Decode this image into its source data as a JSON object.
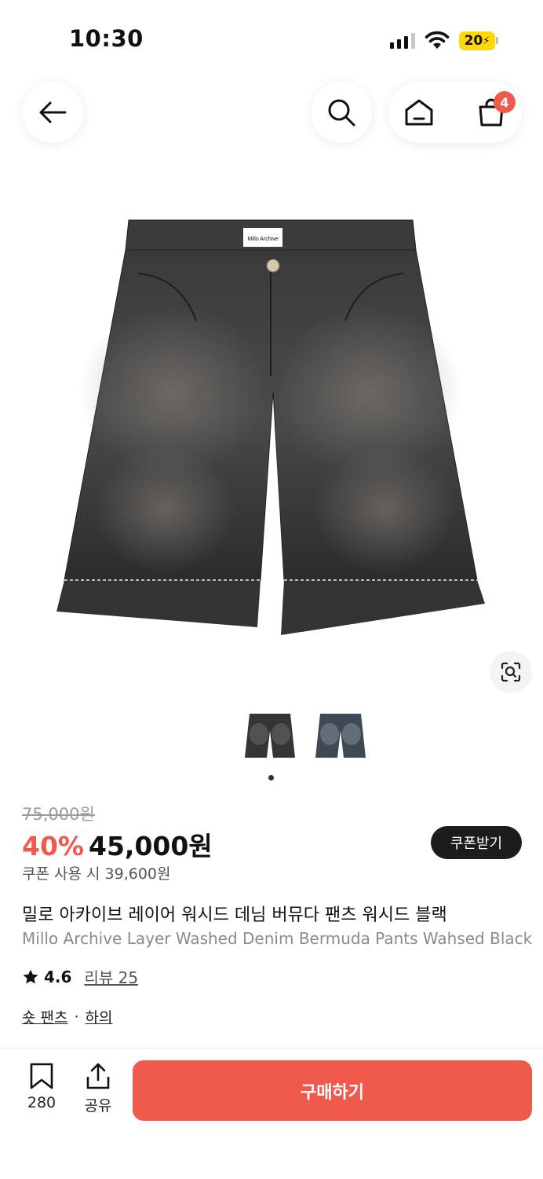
{
  "status_bar": {
    "time": "10:30",
    "battery": "20"
  },
  "nav": {
    "cart_count": "4"
  },
  "product": {
    "brand_label": "Millo Archive",
    "original_price": "75,000원",
    "discount": "40%",
    "price": "45,000원",
    "coupon_button": "쿠폰받기",
    "coupon_note": "쿠폰 사용 시 39,600원",
    "title_ko": "밀로 아카이브 레이어 워시드 데님 버뮤다 팬츠 워시드 블랙",
    "title_en": "Millo Archive Layer Washed Denim Bermuda Pants Wahsed Black",
    "rating": "4.6",
    "review_label": "리뷰 25",
    "category_1": "숏 팬츠",
    "category_sep": "·",
    "category_2": "하의"
  },
  "bottom_bar": {
    "bookmark_count": "280",
    "share_label": "공유",
    "buy_label": "구매하기"
  },
  "colors": {
    "accent": "#ef5a4c",
    "dark_button": "#1c1c1c",
    "battery": "#ffd60a"
  },
  "icons": [
    "back-arrow-icon",
    "search-icon",
    "home-icon",
    "shopping-bag-icon",
    "lens-search-icon",
    "bookmark-icon",
    "share-icon",
    "star-icon"
  ]
}
